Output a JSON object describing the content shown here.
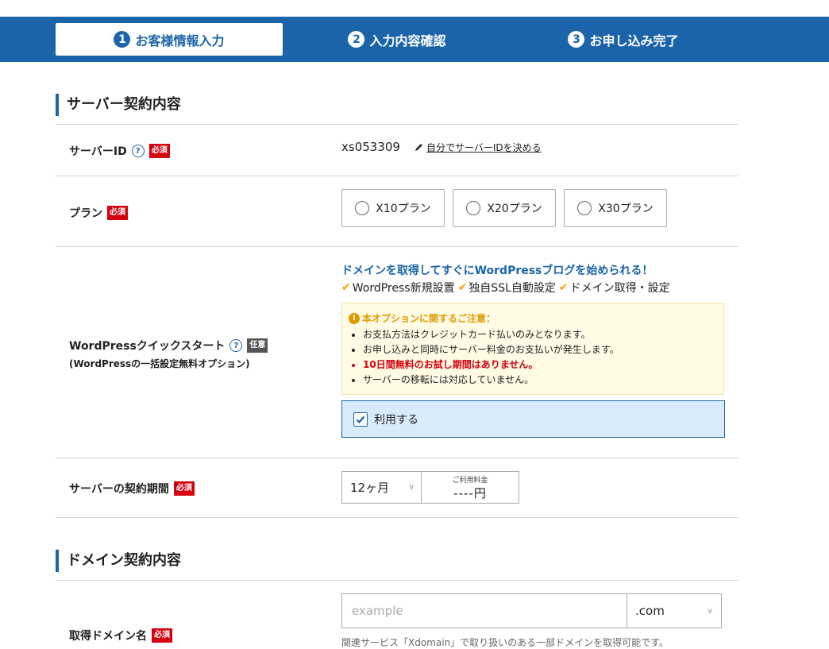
{
  "steps": [
    {
      "num": "1",
      "label": "お客様情報入力"
    },
    {
      "num": "2",
      "label": "入力内容確認"
    },
    {
      "num": "3",
      "label": "お申し込み完了"
    }
  ],
  "server_section": {
    "title": "サーバー契約内容",
    "server_id": {
      "label": "サーバーID",
      "help": "?",
      "required": "必須",
      "value": "xs053309",
      "link": "自分でサーバーIDを決める"
    },
    "plan": {
      "label": "プラン",
      "required": "必須",
      "options": [
        "X10プラン",
        "X20プラン",
        "X30プラン"
      ]
    },
    "wp_quickstart": {
      "label": "WordPressクイックスタート",
      "help": "?",
      "optional": "任意",
      "sublabel": "(WordPressの一括設定無料オプション)",
      "headline": "ドメインを取得してすぐにWordPressブログを始められる！",
      "features": [
        "WordPress新規設置",
        "独自SSL自動設定",
        "ドメイン取得・設定"
      ],
      "notice_title": "本オプションに関するご注意：",
      "notice_items": [
        {
          "text": "お支払方法はクレジットカード払いのみとなります。",
          "highlight": false
        },
        {
          "text": "お申し込みと同時にサーバー料金のお支払いが発生します。",
          "highlight": false
        },
        {
          "text": "10日間無料のお試し期間はありません。",
          "highlight": true
        },
        {
          "text": "サーバーの移転には対応していません。",
          "highlight": false
        }
      ],
      "use_label": "利用する",
      "use_checked": true
    },
    "period": {
      "label": "サーバーの契約期間",
      "required": "必須",
      "value": "12ヶ月",
      "fee_caption": "ご利用料金",
      "fee_value": "----円"
    }
  },
  "domain_section": {
    "title": "ドメイン契約内容",
    "label": "取得ドメイン名",
    "required": "必須",
    "placeholder": "example",
    "tld": ".com",
    "note": "関連サービス「Xdomain」で取り扱いのある一部ドメインを取得可能です。"
  },
  "colors": {
    "brand": "#1b64aa",
    "required": "#d4000f",
    "check": "#f0a500"
  }
}
